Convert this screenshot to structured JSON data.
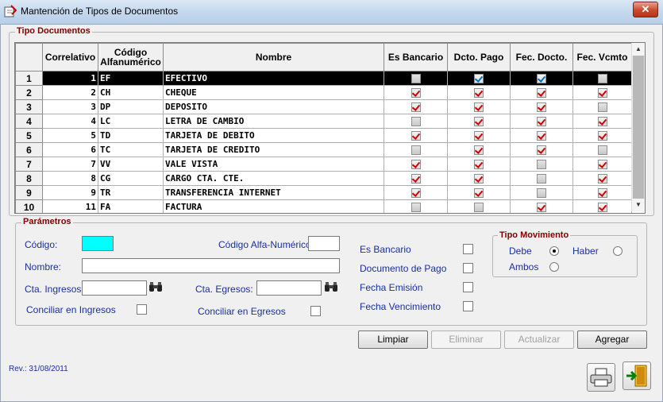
{
  "window": {
    "title": "Mantención de Tipos de Documentos",
    "close_label": "✕"
  },
  "tipo_documentos": {
    "legend": "Tipo Documentos",
    "columns": [
      "Correlativo",
      "Código\nAlfanumérico",
      "Nombre",
      "Es Bancario",
      "Dcto. Pago",
      "Fec. Docto.",
      "Fec. Vcmto"
    ],
    "rows": [
      {
        "row": "1",
        "correlativo": "1",
        "codigo": "EF",
        "nombre": "EFECTIVO",
        "es_bancario": false,
        "dcto_pago": true,
        "fec_docto": true,
        "fec_vcmto": false,
        "selected": true
      },
      {
        "row": "2",
        "correlativo": "2",
        "codigo": "CH",
        "nombre": "CHEQUE",
        "es_bancario": true,
        "dcto_pago": true,
        "fec_docto": true,
        "fec_vcmto": true
      },
      {
        "row": "3",
        "correlativo": "3",
        "codigo": "DP",
        "nombre": "DEPOSITO",
        "es_bancario": true,
        "dcto_pago": true,
        "fec_docto": true,
        "fec_vcmto": false
      },
      {
        "row": "4",
        "correlativo": "4",
        "codigo": "LC",
        "nombre": "LETRA DE CAMBIO",
        "es_bancario": false,
        "dcto_pago": true,
        "fec_docto": true,
        "fec_vcmto": true
      },
      {
        "row": "5",
        "correlativo": "5",
        "codigo": "TD",
        "nombre": "TARJETA DE DEBITO",
        "es_bancario": true,
        "dcto_pago": true,
        "fec_docto": true,
        "fec_vcmto": true
      },
      {
        "row": "6",
        "correlativo": "6",
        "codigo": "TC",
        "nombre": "TARJETA DE CREDITO",
        "es_bancario": false,
        "dcto_pago": true,
        "fec_docto": true,
        "fec_vcmto": false
      },
      {
        "row": "7",
        "correlativo": "7",
        "codigo": "VV",
        "nombre": "VALE VISTA",
        "es_bancario": true,
        "dcto_pago": true,
        "fec_docto": false,
        "fec_vcmto": true
      },
      {
        "row": "8",
        "correlativo": "8",
        "codigo": "CG",
        "nombre": "CARGO CTA. CTE.",
        "es_bancario": true,
        "dcto_pago": true,
        "fec_docto": false,
        "fec_vcmto": true
      },
      {
        "row": "9",
        "correlativo": "9",
        "codigo": "TR",
        "nombre": "TRANSFERENCIA INTERNET",
        "es_bancario": true,
        "dcto_pago": true,
        "fec_docto": false,
        "fec_vcmto": true
      },
      {
        "row": "10",
        "correlativo": "11",
        "codigo": "FA",
        "nombre": "FACTURA",
        "es_bancario": false,
        "dcto_pago": false,
        "fec_docto": true,
        "fec_vcmto": true
      }
    ]
  },
  "parametros": {
    "legend": "Parámetros",
    "codigo_label": "Código:",
    "codigo_value": "",
    "codigo_alfa_label": "Código Alfa-Numérico:",
    "codigo_alfa_value": "",
    "nombre_label": "Nombre:",
    "nombre_value": "",
    "cta_ingresos_label": "Cta. Ingresos:",
    "cta_ingresos_value": "",
    "cta_egresos_label": "Cta. Egresos:",
    "cta_egresos_value": "",
    "conciliar_ingresos_label": "Conciliar en Ingresos",
    "conciliar_egresos_label": "Conciliar en Egresos",
    "es_bancario_label": "Es Bancario",
    "documento_pago_label": "Documento de Pago",
    "fecha_emision_label": "Fecha Emisión",
    "fecha_vencimiento_label": "Fecha Vencimiento",
    "tipo_movimiento": {
      "legend": "Tipo Movimiento",
      "debe_label": "Debe",
      "haber_label": "Haber",
      "ambos_label": "Ambos",
      "selected": "Debe"
    }
  },
  "buttons": {
    "limpiar": "Limpiar",
    "eliminar": "Eliminar",
    "actualizar": "Actualizar",
    "agregar": "Agregar"
  },
  "footer": {
    "revision": "Rev.: 31/08/2011"
  },
  "icons": {
    "print": "printer-icon",
    "exit": "exit-door-icon",
    "search": "binoculars-icon"
  }
}
